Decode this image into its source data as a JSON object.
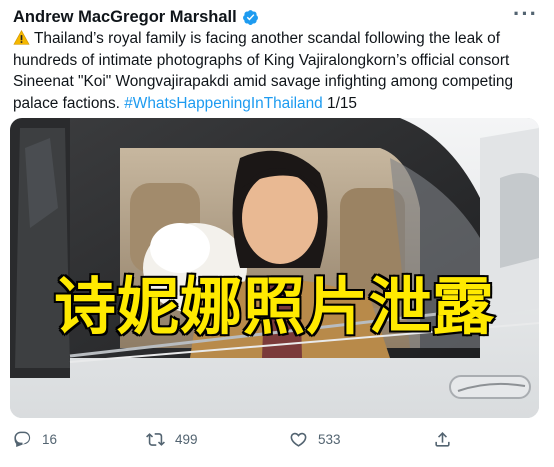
{
  "tweet": {
    "author": "Andrew MacGregor Marshall",
    "verified": true,
    "warning_icon": "warning-icon",
    "text": "Thailand’s royal family is facing another scandal following the leak of hundreds of intimate photographs of King Vajiralongkorn’s official consort Sineenat \"Koi\" Wongvajirapakdi amid savage infighting among competing palace factions.",
    "hashtag": "#WhatsHappeningInThailand",
    "thread_count": "1/15"
  },
  "media": {
    "overlay_text": "诗妮娜照片泄露",
    "overlay_color": "#ffea00"
  },
  "actions": {
    "reply_count": "16",
    "retweet_count": "499",
    "like_count": "533"
  },
  "colors": {
    "verified_blue": "#1d9bf0",
    "hashtag_blue": "#1d9bf0",
    "secondary_text": "#536471"
  }
}
